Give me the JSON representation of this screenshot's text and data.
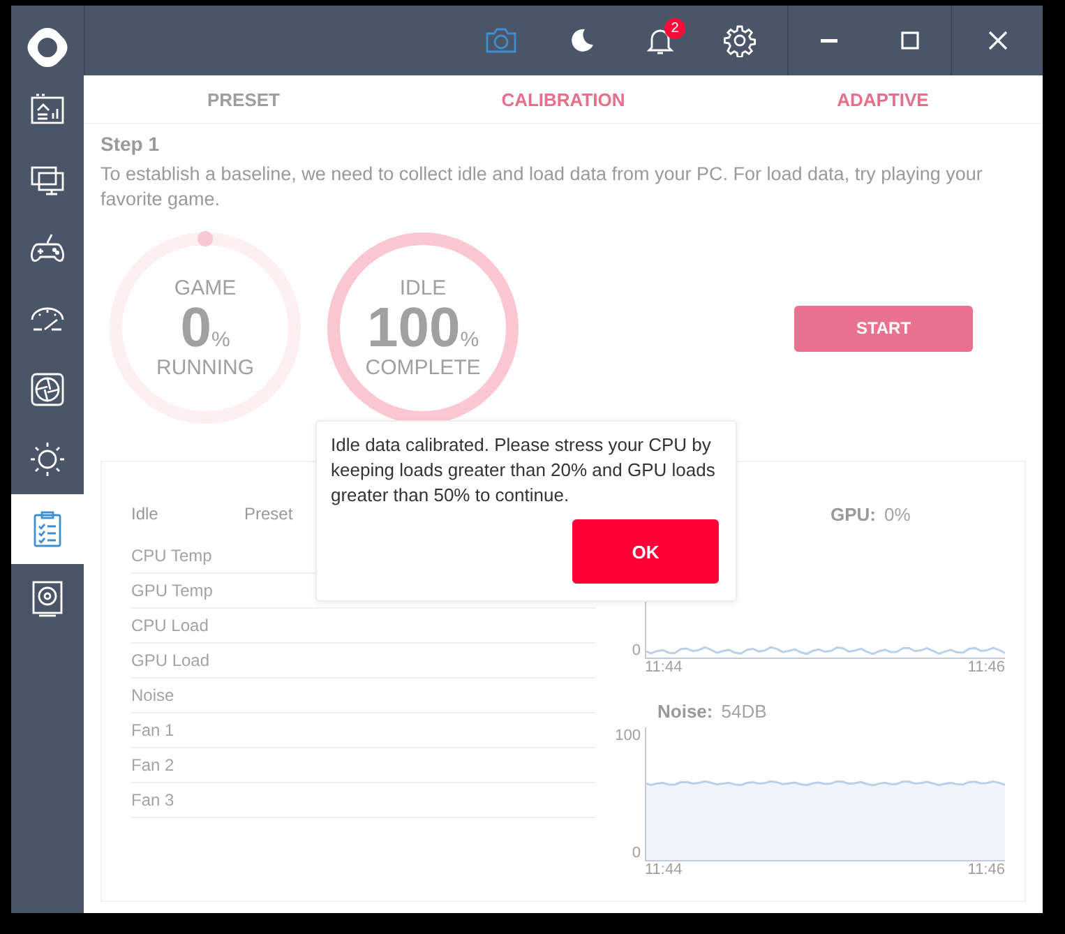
{
  "titlebar": {
    "tools": [
      {
        "kind": "camera",
        "selected": true
      },
      {
        "kind": "moon",
        "selected": false
      },
      {
        "kind": "bell",
        "selected": false,
        "badge": "2"
      },
      {
        "kind": "gear",
        "selected": false
      }
    ]
  },
  "sidebar": {
    "items": [
      {
        "kind": "dashboard",
        "selected": false
      },
      {
        "kind": "monitor",
        "selected": false
      },
      {
        "kind": "gamepad",
        "selected": false
      },
      {
        "kind": "gauge",
        "selected": false
      },
      {
        "kind": "fan",
        "selected": false
      },
      {
        "kind": "brightness",
        "selected": false
      },
      {
        "kind": "clipboard",
        "selected": true
      },
      {
        "kind": "speaker",
        "selected": false
      }
    ]
  },
  "tabs": [
    {
      "label": "PRESET",
      "color": "#9e9e9e"
    },
    {
      "label": "CALIBRATION",
      "color": "#e76f8b"
    },
    {
      "label": "ADAPTIVE",
      "color": "#e76f8b"
    }
  ],
  "step": {
    "title": "Step 1",
    "description": "To establish a baseline, we need to collect idle and load data from your PC. For load data, try playing your favorite game."
  },
  "rings": [
    {
      "top": "GAME",
      "value": "0",
      "unit": "%",
      "bottom": "RUNNING",
      "level": 0
    },
    {
      "top": "IDLE",
      "value": "100",
      "unit": "%",
      "bottom": "COMPLETE",
      "level": 1
    }
  ],
  "start_button": {
    "label": "START",
    "disabled": true
  },
  "table": {
    "columns": [
      "Idle",
      "Preset"
    ],
    "rows": [
      "CPU Temp",
      "GPU Temp",
      "CPU Load",
      "GPU Load",
      "Noise",
      "Fan 1",
      "Fan 2",
      "Fan 3"
    ]
  },
  "charts": [
    {
      "label": "GPU:",
      "reading": "0%",
      "yticks": [
        "0"
      ],
      "xticks": [
        "11:44",
        "11:46"
      ],
      "kind": "low"
    },
    {
      "label": "Noise:",
      "reading": "54DB",
      "yticks": [
        "100",
        "0"
      ],
      "xticks": [
        "11:44",
        "11:46"
      ],
      "kind": "mid"
    }
  ],
  "dialog": {
    "message": "Idle data calibrated. Please stress your CPU by keeping loads greater than 20% and GPU loads greater than 50% to continue.",
    "button": "OK"
  }
}
